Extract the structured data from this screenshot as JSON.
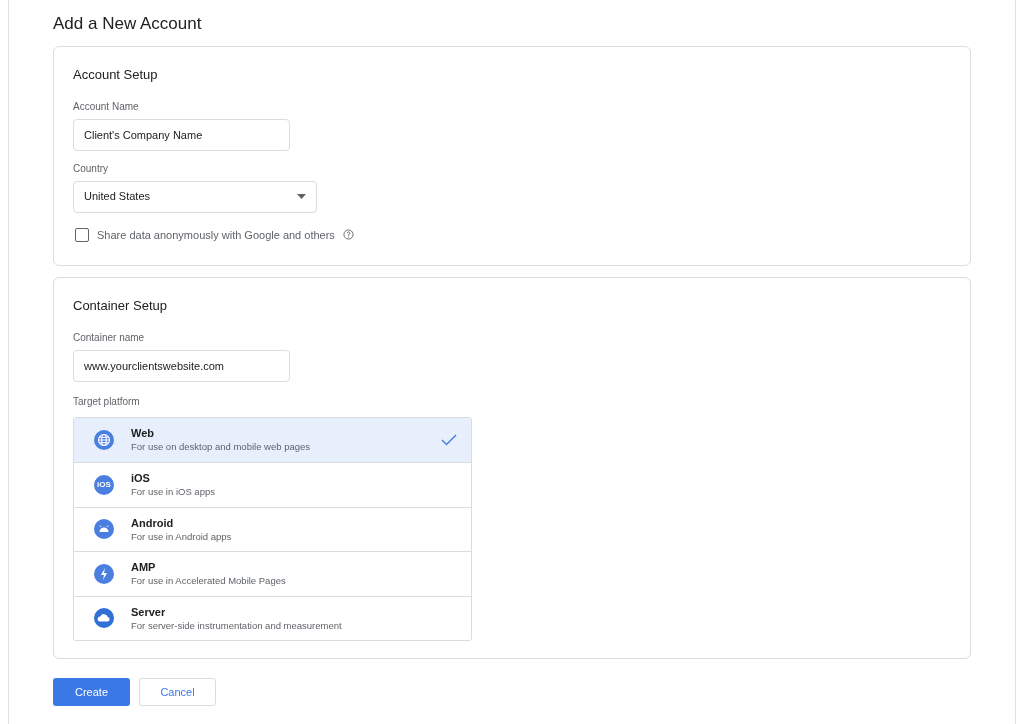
{
  "page_title": "Add a New Account",
  "account_setup": {
    "heading": "Account Setup",
    "account_name": {
      "label": "Account Name",
      "value": "Client's Company Name"
    },
    "country": {
      "label": "Country",
      "value": "United States"
    },
    "share_data": {
      "label": "Share data anonymously with Google and others",
      "checked": false
    }
  },
  "container_setup": {
    "heading": "Container Setup",
    "container_name": {
      "label": "Container name",
      "value": "www.yourclientswebsite.com"
    },
    "platform_label": "Target platform",
    "platforms": [
      {
        "kind": "globe",
        "name": "Web",
        "description": "For use on desktop and mobile web pages",
        "selected": true
      },
      {
        "kind": "text",
        "icon_text": "iOS",
        "name": "iOS",
        "description": "For use in iOS apps",
        "selected": false
      },
      {
        "kind": "android",
        "name": "Android",
        "description": "For use in Android apps",
        "selected": false
      },
      {
        "kind": "bolt",
        "name": "AMP",
        "description": "For use in Accelerated Mobile Pages",
        "selected": false
      },
      {
        "kind": "cloud",
        "name": "Server",
        "description": "For server-side instrumentation and measurement",
        "selected": false
      }
    ]
  },
  "buttons": {
    "create": "Create",
    "cancel": "Cancel"
  }
}
